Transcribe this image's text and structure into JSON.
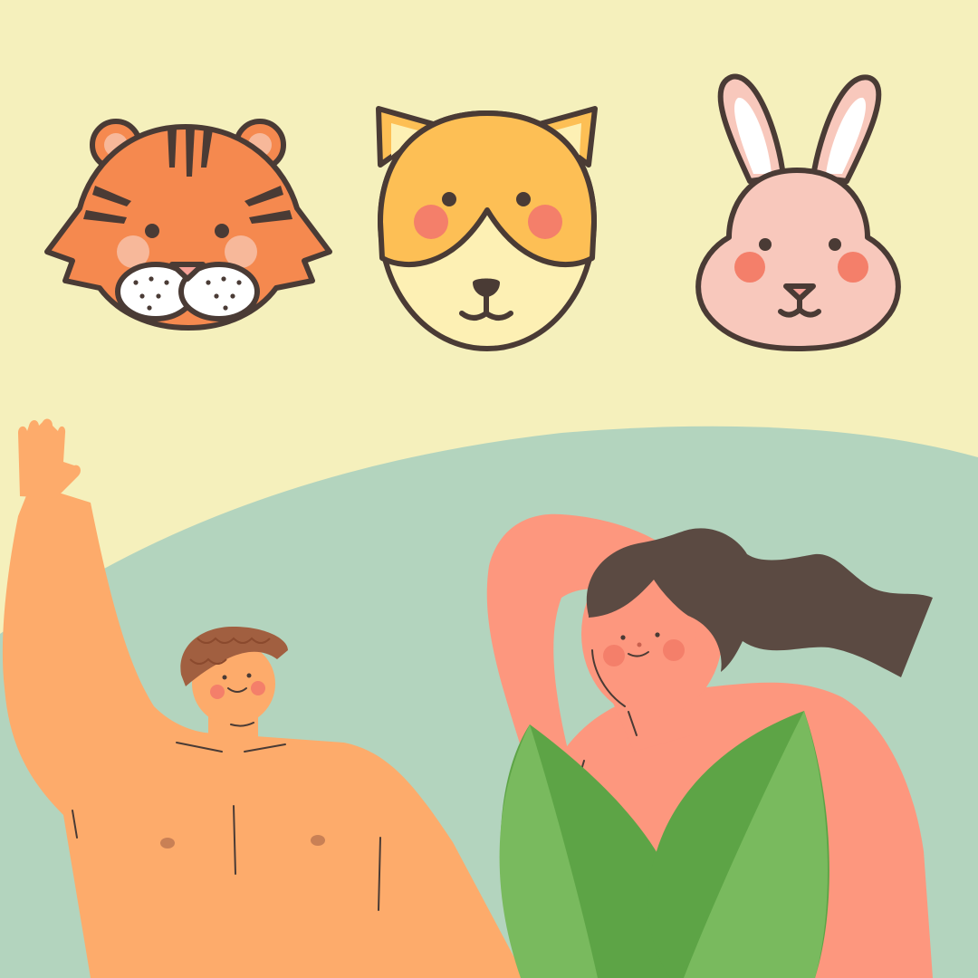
{
  "colors": {
    "background_top": "#f5f0bc",
    "background_hill": "#b3d4be",
    "outline": "#4a3b35",
    "tiger_orange": "#f5894f",
    "tiger_cheek": "#f7b89a",
    "dog_top": "#fdbf55",
    "dog_bottom": "#fdf0b4",
    "blush": "#f47f6a",
    "rabbit_pink": "#f8c8bc",
    "rabbit_inner_ear": "#ffffff",
    "man_skin": "#fdab6b",
    "man_hair": "#a15f40",
    "woman_skin": "#fd977e",
    "woman_hair": "#5b4a42",
    "leaf_dark": "#5da446",
    "leaf_light": "#79ba5e"
  },
  "illustrations": {
    "animals": [
      {
        "id": "tiger",
        "icon": "tiger-face-icon"
      },
      {
        "id": "dog",
        "icon": "dog-face-icon"
      },
      {
        "id": "rabbit",
        "icon": "rabbit-face-icon"
      }
    ],
    "people": [
      {
        "id": "man",
        "pose": "waving"
      },
      {
        "id": "woman",
        "pose": "arm-behind-head"
      }
    ],
    "plants": [
      {
        "id": "leaves",
        "icon": "leaf-icon"
      }
    ]
  }
}
